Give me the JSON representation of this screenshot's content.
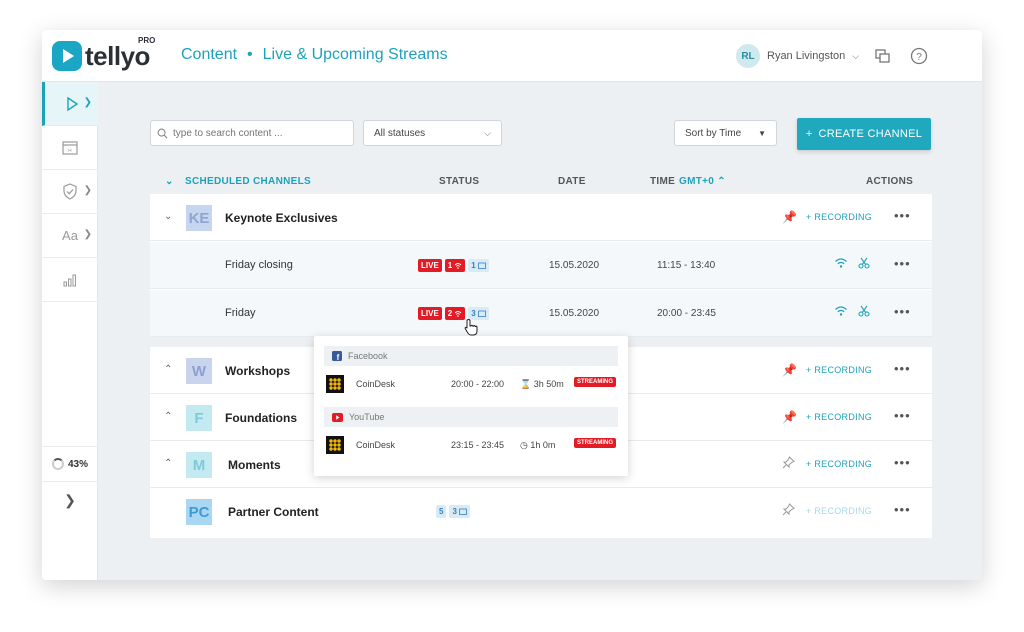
{
  "header": {
    "logo_text": "tellyo",
    "logo_pro": "PRO",
    "breadcrumb_root": "Content",
    "breadcrumb_sep": "•",
    "breadcrumb_current": "Live & Upcoming Streams",
    "user_initials": "RL",
    "user_name": "Ryan Livingston"
  },
  "sidebar": {
    "progress": "43%"
  },
  "toolbar": {
    "search_placeholder": "type to search content ...",
    "status_filter": "All statuses",
    "sort": "Sort by Time",
    "create_label": "CREATE CHANNEL"
  },
  "table_header": {
    "channels": "SCHEDULED CHANNELS",
    "status": "STATUS",
    "date": "DATE",
    "time": "TIME",
    "timezone": "GMT+0",
    "actions": "ACTIONS"
  },
  "recording_label": "RECORDING",
  "live_label": "LIVE",
  "groups": [
    {
      "initials": "KE",
      "name": "Keynote Exclusives",
      "bg": "#c6d6f0",
      "fg": "#8ea6cf"
    },
    {
      "initials": "W",
      "name": "Workshops",
      "bg": "#c9d4ef",
      "fg": "#8fa0cd"
    },
    {
      "initials": "F",
      "name": "Foundations",
      "bg": "#c3eaf0",
      "fg": "#7ccbd6"
    },
    {
      "initials": "M",
      "name": "Moments",
      "bg": "#c3eaf0",
      "fg": "#7ccbd6"
    },
    {
      "initials": "PC",
      "name": "Partner Content",
      "bg": "#a9d7f2",
      "fg": "#3d9ad6"
    }
  ],
  "sub_rows": [
    {
      "name": "Friday closing",
      "streams": "1",
      "scheduled": "1",
      "date": "15.05.2020",
      "time": "11:15 - 13:40"
    },
    {
      "name": "Friday",
      "streams": "2",
      "scheduled": "3",
      "date": "15.05.2020",
      "time": "20:00 - 23:45"
    }
  ],
  "partner": {
    "count": "5",
    "scheduled": "3"
  },
  "popover": {
    "sources": [
      {
        "platform": "Facebook",
        "channel": "CoinDesk",
        "time": "20:00 - 22:00",
        "duration": "3h 50m",
        "state": "STREAMING"
      },
      {
        "platform": "YouTube",
        "channel": "CoinDesk",
        "time": "23:15 - 23:45",
        "duration": "1h 0m",
        "state": "STREAMING"
      }
    ]
  }
}
